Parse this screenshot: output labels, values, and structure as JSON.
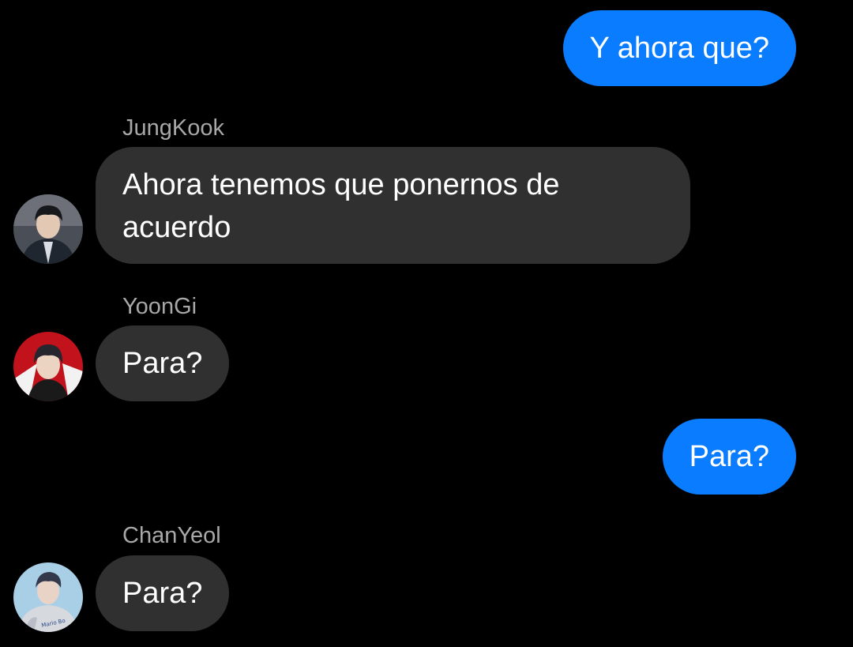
{
  "messages": [
    {
      "type": "outgoing",
      "text": "Y ahora que?"
    },
    {
      "type": "incoming",
      "sender": "JungKook",
      "text": "Ahora tenemos que ponernos de acuerdo"
    },
    {
      "type": "incoming",
      "sender": "YoonGi",
      "text": "Para?"
    },
    {
      "type": "outgoing",
      "text": "Para?"
    },
    {
      "type": "incoming",
      "sender": "ChanYeol",
      "text": "Para?"
    }
  ],
  "avatar_logo_text": "Mario Bo",
  "colors": {
    "background": "#000000",
    "outgoing_bubble": "#0a7cff",
    "incoming_bubble": "#303030",
    "sender_name": "#a8a8a8"
  }
}
